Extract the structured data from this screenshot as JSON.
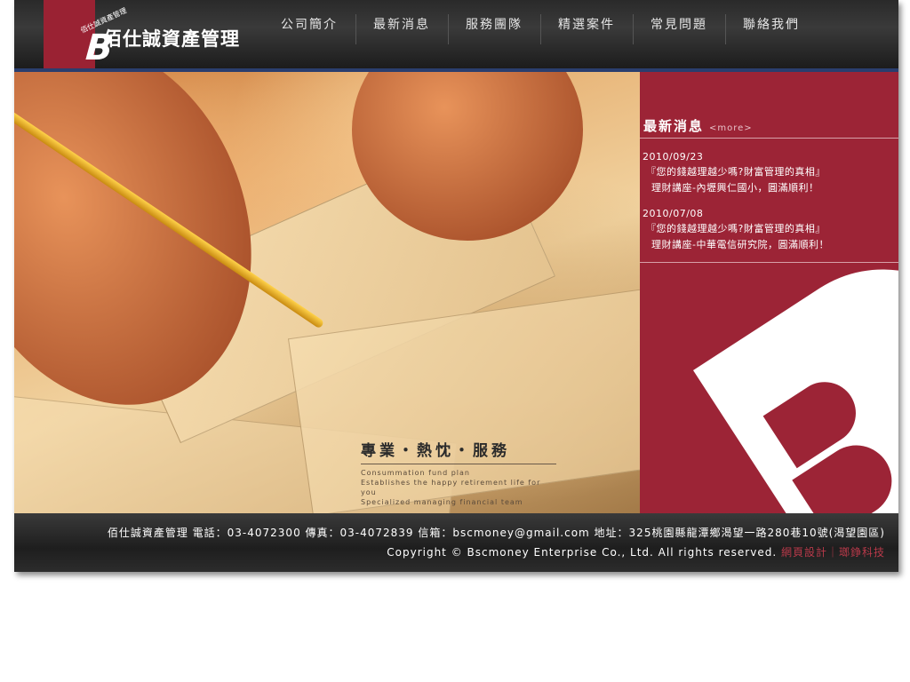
{
  "brand": {
    "logo_small_text": "佰仕誠資產管理",
    "logo_letter": "B",
    "title": "佰仕誠資產管理"
  },
  "nav": {
    "items": [
      {
        "label": "公司簡介"
      },
      {
        "label": "最新消息"
      },
      {
        "label": "服務團隊"
      },
      {
        "label": "精選案件"
      },
      {
        "label": "常見問題"
      },
      {
        "label": "聯絡我們"
      }
    ]
  },
  "hero": {
    "tagline": "專業・熱忱・服務",
    "sub_lines": [
      "Consummation fund plan",
      "Establishes the happy retirement life for you",
      "Specialized managing financial team"
    ]
  },
  "news": {
    "heading": "最新消息",
    "more": "<more>",
    "items": [
      {
        "date": "2010/09/23",
        "line1": "『您的錢越理越少嗎?財富管理的真相』",
        "line2": "理財講座-內壢興仁國小，圓滿順利！"
      },
      {
        "date": "2010/07/08",
        "line1": "『您的錢越理越少嗎?財富管理的真相』",
        "line2": "理財講座-中華電信研究院，圓滿順利！"
      }
    ]
  },
  "footer": {
    "info": "佰仕誠資產管理 電話：03-4072300  傳真：03-4072839  信箱：bscmoney@gmail.com  地址：325桃園縣龍潭鄉渴望一路280巷10號(渴望園區)",
    "copyright": "Copyright © Bscmoney Enterprise Co., Ltd. All rights reserved.",
    "credit": "網頁設計｜瑯錚科技"
  },
  "colors": {
    "brand_red": "#9c2436",
    "header_dark": "#2a2a2a",
    "accent_blue": "#2a3e6e"
  }
}
